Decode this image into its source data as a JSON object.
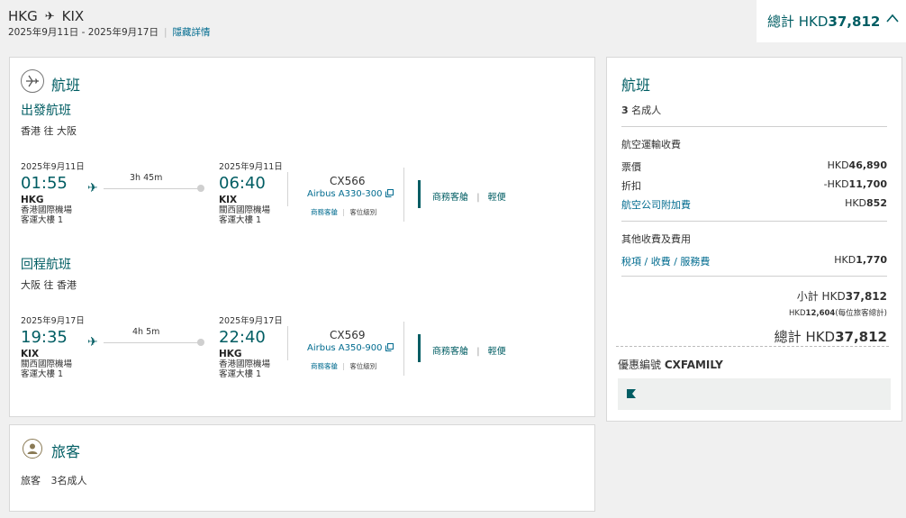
{
  "header": {
    "origin": "HKG",
    "destination": "KIX",
    "date_range": "2025年9月11日 - 2025年9月17日",
    "hide_details": "隱藏詳情",
    "total_label": "總計 HKD",
    "total_amount": "37,812"
  },
  "flights_section": {
    "title": "航班",
    "outbound": {
      "heading": "出發航班",
      "route_desc": "香港 往 大阪",
      "dep_date": "2025年9月11日",
      "dep_time": "01:55",
      "dep_code": "HKG",
      "dep_airport": "香港國際機場",
      "dep_terminal": "客運大樓 1",
      "duration": "3h 45m",
      "arr_date": "2025年9月11日",
      "arr_time": "06:40",
      "arr_code": "KIX",
      "arr_airport": "關西國際機場",
      "arr_terminal": "客運大樓 1",
      "flight_number": "CX566",
      "aircraft": "Airbus A330-300",
      "cabin_small": "商務客艙",
      "class_small": "客位級別",
      "cabin": "商務客艙",
      "fare": "輕便"
    },
    "return": {
      "heading": "回程航班",
      "route_desc": "大阪 往 香港",
      "dep_date": "2025年9月17日",
      "dep_time": "19:35",
      "dep_code": "KIX",
      "dep_airport": "關西國際機場",
      "dep_terminal": "客運大樓 1",
      "duration": "4h 5m",
      "arr_date": "2025年9月17日",
      "arr_time": "22:40",
      "arr_code": "HKG",
      "arr_airport": "香港國際機場",
      "arr_terminal": "客運大樓 1",
      "flight_number": "CX569",
      "aircraft": "Airbus A350-900",
      "cabin_small": "商務客艙",
      "class_small": "客位級別",
      "cabin": "商務客艙",
      "fare": "輕便"
    }
  },
  "passengers_section": {
    "title": "旅客",
    "label": "旅客",
    "value": "3名成人"
  },
  "summary": {
    "title": "航班",
    "pax_count": "3",
    "pax_label": "名成人",
    "air_transport_heading": "航空運輸收費",
    "fare_label": "票價",
    "fare_currency": "HKD",
    "fare_amount": "46,890",
    "discount_label": "折扣",
    "discount_currency": "-HKD",
    "discount_amount": "11,700",
    "surcharge_label": "航空公司附加費",
    "surcharge_currency": "HKD",
    "surcharge_amount": "852",
    "other_heading": "其他收費及費用",
    "taxes_label": "稅項 / 收費 / 服務費",
    "taxes_currency": "HKD",
    "taxes_amount": "1,770",
    "subtotal_label": "小計 HKD",
    "subtotal_amount": "37,812",
    "per_pax_currency": "HKD",
    "per_pax_amount": "12,604",
    "per_pax_note": "(每位旅客總計)",
    "total_label": "總計 HKD",
    "total_amount": "37,812",
    "promo_label": "優惠編號 ",
    "promo_code": "CXFAMILY"
  },
  "colors": {
    "accent": "#005d63",
    "link": "#006b8f"
  },
  "icons": [
    "plane-icon",
    "chevron-up-icon",
    "plane-circle-icon",
    "passenger-icon",
    "copy-icon",
    "flag-icon"
  ]
}
